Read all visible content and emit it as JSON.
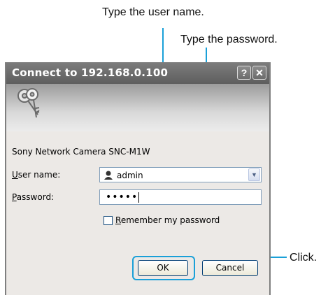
{
  "annotations": {
    "username": "Type the user name.",
    "password": "Type the password.",
    "click": "Click."
  },
  "dialog": {
    "title": "Connect to 192.168.0.100",
    "help_glyph": "?",
    "close_glyph": "✕",
    "realm": "Sony Network Camera SNC-M1W",
    "username_label_key": "U",
    "username_label_rest": "ser name:",
    "password_label_key": "P",
    "password_label_rest": "assword:",
    "username_value": "admin",
    "password_value": "•••••",
    "remember_key": "R",
    "remember_rest": "emember my password",
    "ok_label": "OK",
    "cancel_label": "Cancel",
    "dropdown_glyph": "▼"
  },
  "colors": {
    "accent": "#1aa0d8",
    "titlebar": "#6e6e6e"
  },
  "icons": [
    "keys-icon",
    "user-icon",
    "help-icon",
    "close-icon",
    "chevron-down-icon"
  ]
}
